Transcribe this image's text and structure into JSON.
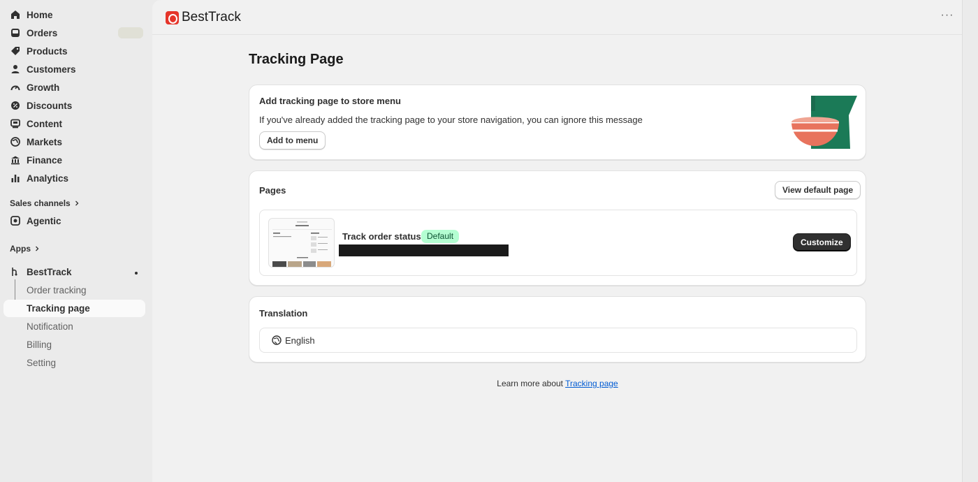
{
  "sidebar": {
    "items": [
      {
        "label": "Home",
        "icon": "home-icon"
      },
      {
        "label": "Orders",
        "icon": "inbox-icon"
      },
      {
        "label": "Products",
        "icon": "tag-icon"
      },
      {
        "label": "Customers",
        "icon": "person-icon"
      },
      {
        "label": "Growth",
        "icon": "gauge-icon"
      },
      {
        "label": "Discounts",
        "icon": "discount-icon"
      },
      {
        "label": "Content",
        "icon": "content-icon"
      },
      {
        "label": "Markets",
        "icon": "globe-icon"
      },
      {
        "label": "Finance",
        "icon": "bank-icon"
      },
      {
        "label": "Analytics",
        "icon": "bar-chart-icon"
      }
    ],
    "sales_channels_label": "Sales channels",
    "agentic_label": "Agentic",
    "apps_label": "Apps",
    "app_name": "BestTrack",
    "sub_items": [
      {
        "label": "Order tracking"
      },
      {
        "label": "Tracking page"
      },
      {
        "label": "Notification"
      },
      {
        "label": "Billing"
      },
      {
        "label": "Setting"
      }
    ]
  },
  "header": {
    "app_title": "BestTrack",
    "more_label": "···"
  },
  "main": {
    "page_title": "Tracking Page",
    "add_card": {
      "title": "Add tracking page to store menu",
      "text": "If you've already added the tracking page to your store navigation, you can ignore this message",
      "button": "Add to menu"
    },
    "pages_card": {
      "title": "Pages",
      "view_button": "View default page",
      "page_name": "Track order status",
      "badge": "Default",
      "customize_button": "Customize"
    },
    "translation_card": {
      "title": "Translation",
      "language": "English"
    },
    "footer": {
      "text": "Learn more about ",
      "link": "Tracking page"
    }
  },
  "colors": {
    "accent_dark": "#303030",
    "badge_bg": "#b4fed2",
    "brand_red": "#e5352a",
    "link": "#005bd3"
  }
}
